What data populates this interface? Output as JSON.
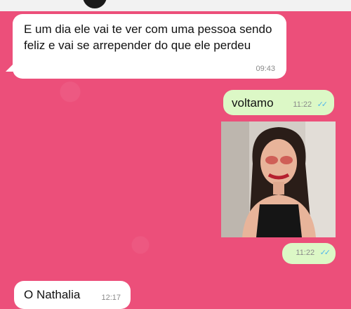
{
  "messages": [
    {
      "direction": "incoming",
      "text": "E um dia ele vai te ver com uma pessoa sendo feliz e vai se arrepender do que ele perdeu",
      "time": "09:43"
    },
    {
      "direction": "outgoing",
      "text": "voltamo",
      "time": "11:22",
      "status": "read-ticks-icon"
    },
    {
      "direction": "outgoing",
      "type": "photo",
      "time": "11:22",
      "status": "read-ticks-icon"
    },
    {
      "direction": "incoming",
      "text": "O Nathalia",
      "time": "12:17"
    }
  ],
  "ticks_glyph": "✓✓",
  "colors": {
    "chat_background": "#ec4f7a",
    "incoming_bubble": "#ffffff",
    "outgoing_bubble": "#dcf8c6",
    "read_ticks": "#4fb6ec"
  }
}
